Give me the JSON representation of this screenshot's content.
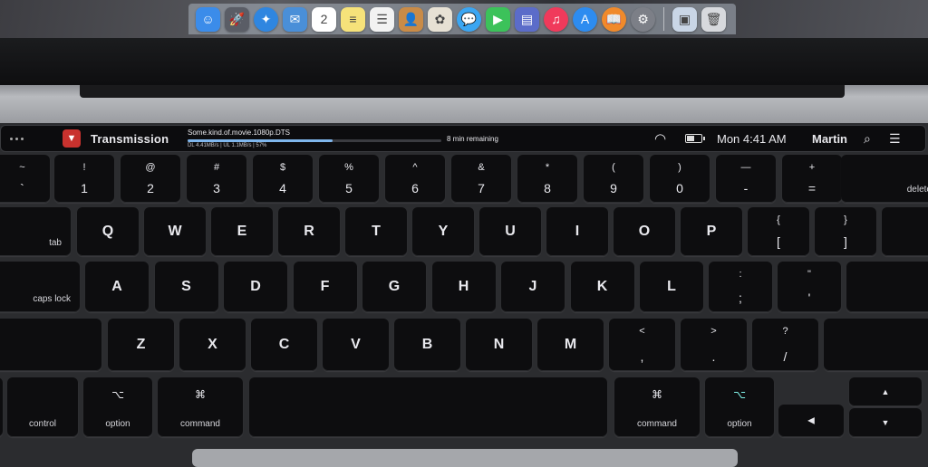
{
  "dock": {
    "icons": [
      {
        "name": "finder-icon",
        "glyph": "☺",
        "color": "#3b8cea"
      },
      {
        "name": "launchpad-icon",
        "glyph": "🚀",
        "color": "#5a5d66"
      },
      {
        "name": "safari-icon",
        "glyph": "✦",
        "color": "#2f86e0"
      },
      {
        "name": "mail-icon",
        "glyph": "✉",
        "color": "#4a8fd8"
      },
      {
        "name": "calendar-icon",
        "glyph": "2",
        "color": "#ffffff"
      },
      {
        "name": "notes-icon",
        "glyph": "≡",
        "color": "#f6e27a"
      },
      {
        "name": "reminders-icon",
        "glyph": "☰",
        "color": "#f2f2f2"
      },
      {
        "name": "contacts-icon",
        "glyph": "👤",
        "color": "#c98b47"
      },
      {
        "name": "photos-icon",
        "glyph": "✿",
        "color": "#e7e1d4"
      },
      {
        "name": "messages-icon",
        "glyph": "💬",
        "color": "#3ba6f2"
      },
      {
        "name": "facetime-icon",
        "glyph": "▶",
        "color": "#3cc25a"
      },
      {
        "name": "keynote-icon",
        "glyph": "▤",
        "color": "#5b6cc9"
      },
      {
        "name": "itunes-icon",
        "glyph": "♫",
        "color": "#f03a5b"
      },
      {
        "name": "app-store-icon",
        "glyph": "A",
        "color": "#2d8cf0"
      },
      {
        "name": "ibooks-icon",
        "glyph": "📖",
        "color": "#f08a2b"
      },
      {
        "name": "system-preferences-icon",
        "glyph": "⚙",
        "color": "#7c7f87"
      },
      {
        "name": "preview-icon",
        "glyph": "▣",
        "color": "#c9d6e6"
      },
      {
        "name": "trash-icon",
        "glyph": "🗑",
        "color": "#d7d9dd"
      }
    ]
  },
  "touchbar": {
    "app_name": "Transmission",
    "file_name": "Some.kind.of.movie.1080p.DTS",
    "progress": 0.57,
    "stats": "DL 4.41MB/s | UL 1.1MB/s | 57%",
    "remaining": "8 min remaining",
    "clock": "Mon 4:41 AM",
    "user": "Martin"
  },
  "keys": {
    "row1": [
      {
        "top": "~",
        "bottom": "`"
      },
      {
        "top": "!",
        "bottom": "1"
      },
      {
        "top": "@",
        "bottom": "2"
      },
      {
        "top": "#",
        "bottom": "3"
      },
      {
        "top": "$",
        "bottom": "4"
      },
      {
        "top": "%",
        "bottom": "5"
      },
      {
        "top": "^",
        "bottom": "6"
      },
      {
        "top": "&",
        "bottom": "7"
      },
      {
        "top": "*",
        "bottom": "8"
      },
      {
        "top": "(",
        "bottom": "9"
      },
      {
        "top": ")",
        "bottom": "0"
      },
      {
        "top": "—",
        "bottom": "-"
      },
      {
        "top": "+",
        "bottom": "="
      }
    ],
    "delete": "delete",
    "tab": "tab",
    "row2": [
      "Q",
      "W",
      "E",
      "R",
      "T",
      "Y",
      "U",
      "I",
      "O",
      "P"
    ],
    "row2_brackets": [
      {
        "top": "{",
        "bottom": "["
      },
      {
        "top": "}",
        "bottom": "]"
      }
    ],
    "caps": "caps lock",
    "row3": [
      "A",
      "S",
      "D",
      "F",
      "G",
      "H",
      "J",
      "K",
      "L"
    ],
    "row3_punct": [
      {
        "top": ":",
        "bottom": ";"
      },
      {
        "top": "\"",
        "bottom": "'"
      }
    ],
    "row4": [
      "Z",
      "X",
      "C",
      "V",
      "B",
      "N",
      "M"
    ],
    "row4_punct": [
      {
        "top": "<",
        "bottom": ","
      },
      {
        "top": ">",
        "bottom": "."
      },
      {
        "top": "?",
        "bottom": "/"
      }
    ],
    "control": "control",
    "option": "option",
    "command": "command",
    "alt_glyph": "⌥",
    "cmd_glyph": "⌘",
    "left_arrow": "◀",
    "up_arrow": "▲",
    "down_arrow": "▼"
  }
}
